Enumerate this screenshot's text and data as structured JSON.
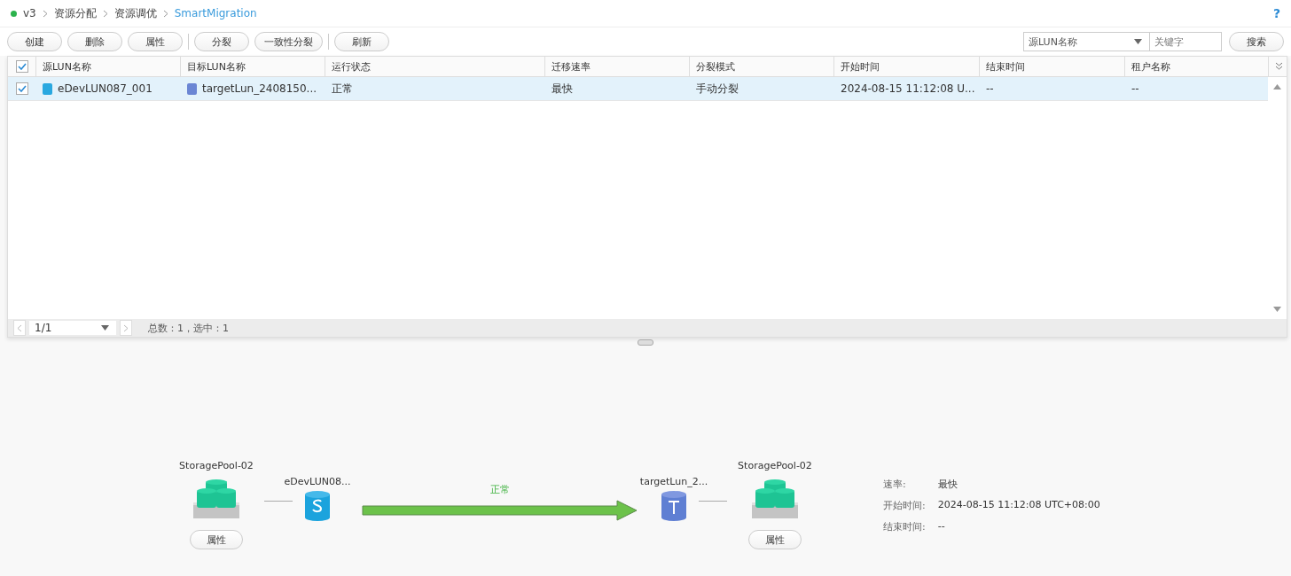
{
  "breadcrumb": [
    {
      "label": "v3",
      "current": false
    },
    {
      "label": "资源分配",
      "current": false
    },
    {
      "label": "资源调优",
      "current": false
    },
    {
      "label": "SmartMigration",
      "current": true
    }
  ],
  "help": "?",
  "toolbar": {
    "groups": [
      [
        "创建",
        "删除",
        "属性"
      ],
      [
        "分裂",
        "一致性分裂"
      ],
      [
        "刷新"
      ]
    ]
  },
  "search": {
    "filter": "源LUN名称",
    "placeholder": "关键字",
    "button": "搜索"
  },
  "table": {
    "all_checked": true,
    "columns": [
      "源LUN名称",
      "目标LUN名称",
      "运行状态",
      "迁移速率",
      "分裂模式",
      "开始时间",
      "结束时间",
      "租户名称"
    ],
    "rows": [
      {
        "checked": true,
        "selected": true,
        "cells": [
          "eDevLUN087_001",
          "targetLun_2408150...",
          "正常",
          "最快",
          "手动分裂",
          "2024-08-15 11:12:08 U...",
          "--",
          "--"
        ]
      }
    ]
  },
  "pager": {
    "page": "1/1",
    "summary": "总数：1，选中：1"
  },
  "diagram": {
    "source_pool": {
      "name": "StoragePool-02",
      "button": "属性"
    },
    "source_lun": "eDevLUN08...",
    "status": "正常",
    "target_lun": "targetLun_2...",
    "target_pool": {
      "name": "StoragePool-02",
      "button": "属性"
    },
    "details": [
      {
        "label": "速率:",
        "value": "最快"
      },
      {
        "label": "开始时间:",
        "value": "2024-08-15 11:12:08 UTC+08:00"
      },
      {
        "label": "结束时间:",
        "value": "--"
      }
    ]
  }
}
